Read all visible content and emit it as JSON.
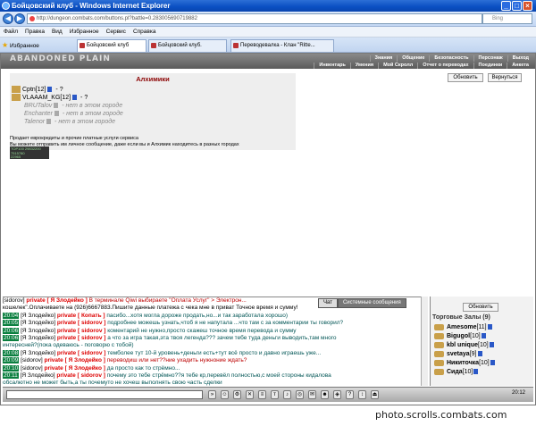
{
  "window": {
    "title": "Бойцовский клуб - Windows Internet Explorer"
  },
  "address": {
    "url": "http://dungeon.combats.com/buttons.pl?battle=0.283005690719882",
    "search_placeholder": "Bing"
  },
  "menubar": {
    "items": [
      "Файл",
      "Правка",
      "Вид",
      "Избранное",
      "Сервис",
      "Справка"
    ]
  },
  "favorites_label": "Избранное",
  "tabs": [
    {
      "label": "Бойцовский клуб"
    },
    {
      "label": "Бойцовский клуб."
    },
    {
      "label": "Переводевалка - Клан \"Ritte..."
    }
  ],
  "game": {
    "logo": "ABANDONED PLAIN",
    "menu_top": [
      "Знания",
      "Общение",
      "Безопасность",
      "Персонаж",
      "Выход"
    ],
    "menu_bottom": [
      "Инвентарь",
      "Умения",
      "Мой Скролл",
      "Отчет о переводах",
      "Поединки",
      "Анкета"
    ],
    "panel_title": "Алхимики",
    "refresh_label": "Обновить",
    "back_label": "Вернуться",
    "alchemists": [
      {
        "name": "Cptn",
        "level": "[12]",
        "status": " - ?",
        "online": true
      },
      {
        "name": "VLAAAM_KG",
        "level": "[12]",
        "status": " - ?",
        "online": true
      },
      {
        "name": "BRUTalov",
        "level": "",
        "status": " - нет в этом городе",
        "online": false
      },
      {
        "name": "Enchanter",
        "level": "",
        "status": " - нет в этом городе",
        "online": false
      },
      {
        "name": "Talenor",
        "level": "",
        "status": " - нет в этом городе",
        "online": false
      }
    ],
    "info_line1": "Продает еврокредиты и прочие платные услуги сервиса",
    "info_line2": "Вы можете отправить им личное сообщение, даже если вы и Алхимик находитесь в разных городах",
    "counter": [
      "TOP100 29832200",
      "7515780",
      "22965"
    ]
  },
  "chat": {
    "tabs": [
      "Чат",
      "Системные сообщения"
    ],
    "lines": [
      {
        "time": "",
        "from": "[sidorov]",
        "priv": "private [ Я Злодейко ]",
        "text": "В терминале Qiwi выбираете \"Оплата Услуг\" > Электрон...",
        "cls": "msg"
      },
      {
        "time": "",
        "from": "",
        "priv": "",
        "text": "кошелек\".Оплачиваете на (926)6667883.Пишите данные платежа с чека мне в приват Точное время и сумму!",
        "cls": "nm"
      },
      {
        "time": "20:04",
        "from": "[Я Злодейко]",
        "priv": "private [ Копать ]",
        "text": "пасибо...хотя могла дороже продать,но...и так заработала хорошо)",
        "cls": "green"
      },
      {
        "time": "20:05",
        "from": "[Я Злодейко]",
        "priv": "private [ sidorov ]",
        "text": "подробнее можешь узнать,чтоб я не напутала ...что там с за комментарии ты говорил?",
        "cls": "green"
      },
      {
        "time": "20:06",
        "from": "[Я Злодейко]",
        "priv": "private [ sidorov ]",
        "text": "коментарий не нужно,просто скажеш точное время перевода и сумму",
        "cls": "green"
      },
      {
        "time": "20:06",
        "from": "[Я Злодейко]",
        "priv": "private [ sidorov ]",
        "text": "а что за игра такая,эта твоя легенда??? зачем тебе туда деньги выводить,там много",
        "cls": "green"
      },
      {
        "time": "",
        "from": "",
        "priv": "",
        "text": "интересней?(пока одеваюсь - поговорю с тобой)",
        "cls": "green"
      },
      {
        "time": "20:08",
        "from": "[Я Злодейко]",
        "priv": "private [ sidorov ]",
        "text": "темболее тут 10-й уровень+деньги есть+тут всё просто и давно играешь уже...",
        "cls": "green"
      },
      {
        "time": "20:09",
        "from": "[sidorov]",
        "priv": "private [ Я Злодейко ]",
        "text": "переводиш или нет??ние ухадить нужноние ждать?",
        "cls": "msg"
      },
      {
        "time": "20:10",
        "from": "[sidorov]",
        "priv": "private [ Я Злодейко ]",
        "text": "да просто как то стрёмно...",
        "cls": "green"
      },
      {
        "time": "20:11",
        "from": "[Я Злодейко]",
        "priv": "private [ sidorov ]",
        "text": "почему это тебе стрёмно??я тебе кр,перевёл полностью,с моей стороны кидалова",
        "cls": "green"
      },
      {
        "time": "",
        "from": "",
        "priv": "",
        "text": "обсалютно не может быть,а ты почемуто не хочеш выполнять свою часть сделки",
        "cls": "green"
      }
    ]
  },
  "rooms": {
    "refresh_label": "Обновить",
    "title": "Торговые Залы",
    "count": "(9)",
    "users": [
      {
        "name": "Amesome",
        "level": "[11]"
      },
      {
        "name": "Bigugol",
        "level": "[10]"
      },
      {
        "name": "kbl unique",
        "level": "[10]"
      },
      {
        "name": "svetaya",
        "level": "[9]"
      },
      {
        "name": "Никиточка",
        "level": "[10]"
      },
      {
        "name": "Сида",
        "level": "[10]"
      }
    ]
  },
  "toolbar": {
    "clock": "20:12"
  },
  "footer": "photo.scrolls.combats.com"
}
